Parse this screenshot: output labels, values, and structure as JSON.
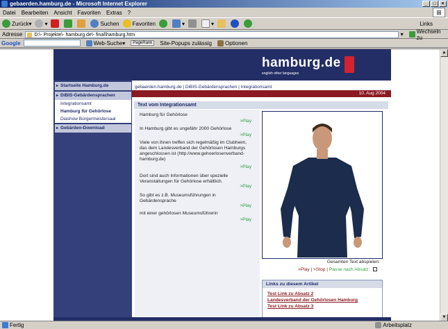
{
  "window": {
    "title": "gebaerden.hamburg.de - Microsoft Internet Explorer"
  },
  "menu": [
    "Datei",
    "Bearbeiten",
    "Ansicht",
    "Favoriten",
    "Extras",
    "?"
  ],
  "toolbar": {
    "back": "Zurück",
    "search": "Suchen",
    "favorites": "Favoriten",
    "links": "Links"
  },
  "address": {
    "label": "Adresse",
    "value": "D:\\- Projekte\\- hamburg.de\\- final\\hamburg.htm",
    "go": "Wechseln zu"
  },
  "google": {
    "label": "Google",
    "web_search": "Web-Suche",
    "pagerank": "PageRank",
    "popups": "Site-Popups zulässig",
    "options": "Optionen"
  },
  "site": {
    "logo": "hamburg.de",
    "langs": "english   other languages",
    "nav": {
      "home": "Startseite Hamburg.de",
      "dibis": "DiBIS-Gebärdensprachen",
      "sub": [
        "Integrationsamt",
        "Hamburg für Gehörlose",
        "Diashow Bürgermeistersaal"
      ],
      "download": "Gebärden-Download"
    },
    "breadcrumb": "gebaerden.hamburg.de | DiBIS-Gebärdensprachen | Integrationsamt",
    "date": "10. Aug 2004",
    "section_title": "Text vom Integrationsamt",
    "paragraphs": [
      "Hamburg für Gehörlose",
      "In Hamburg gibt es ungefähr 2000 Gehörlose",
      "Viele von ihnen treffen sich regelmäßig im Clubheim, das dem Landesverband der Gehörlosen Hamburgs angeschlossen ist (http://www.gehoerlosenverband-hamburg.de)",
      "Dort sind auch Informationen über spezielle Veranstaltungen für Gehörlose erhältlich.",
      "So gibt es z.B. Museumsführungen in Gebärdensprache",
      "mit einer gehörlosen Museumsführerin"
    ],
    "play_label": ">Play",
    "controls": {
      "caption": "Gesamten Text abspielen:",
      "play": ">Play",
      "stop": ">Stop",
      "pause": "Pause nach Absatz:"
    },
    "links": {
      "title": "Links zu diesem Artikel",
      "items": [
        "Test Link zu Absatz 2",
        "Landesverband der Gehörlosen Hamburg",
        "Test Link zu Absatz 3"
      ]
    }
  },
  "status": {
    "left": "Fertig",
    "right": "Arbeitsplatz"
  }
}
